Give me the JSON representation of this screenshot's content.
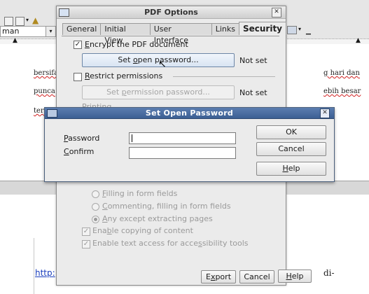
{
  "background_app": {
    "font_name": "man",
    "doc_words": [
      "bersifa",
      "punca",
      "ter",
      "http:",
      "g hari dan",
      "ebih besar",
      "di-"
    ]
  },
  "pdf_options": {
    "title": "PDF Options",
    "tabs": [
      "General",
      "Initial View",
      "User Interface",
      "Links",
      "Security"
    ],
    "active_tab": "Security",
    "encrypt_label_pre": "",
    "encrypt_label_u": "E",
    "encrypt_label_post": "ncrypt the PDF document",
    "set_open_password_pre": "Set ",
    "set_open_password_u": "o",
    "set_open_password_post": "pen password...",
    "open_status": "Not set",
    "restrict_label_pre": "",
    "restrict_label_u": "R",
    "restrict_label_post": "estrict permissions",
    "set_permission_pre": "Set ",
    "set_permission_u": "p",
    "set_permission_post": "ermission password...",
    "permission_status": "Not set",
    "printing_label": "Printing",
    "changes": [
      {
        "pre": "",
        "u": "F",
        "post": "illing in form fields"
      },
      {
        "pre": "",
        "u": "C",
        "post": "ommenting, filling in form fields"
      },
      {
        "pre": "",
        "u": "A",
        "post": "ny except extracting pages"
      }
    ],
    "copy_label_pre": "Ena",
    "copy_label_u": "b",
    "copy_label_post": "le copying of content",
    "access_label_pre": "Enable text access for acce",
    "access_label_u": "s",
    "access_label_post": "sibility tools",
    "export_pre": "E",
    "export_u": "x",
    "export_post": "port",
    "cancel": "Cancel",
    "help_u": "H",
    "help_post": "elp"
  },
  "set_open_password": {
    "title": "Set Open Password",
    "password_u": "P",
    "password_post": "assword",
    "confirm_u": "C",
    "confirm_post": "onfirm",
    "password_value": "",
    "confirm_value": "",
    "ok": "OK",
    "cancel": "Cancel",
    "help_u": "H",
    "help_post": "elp"
  }
}
